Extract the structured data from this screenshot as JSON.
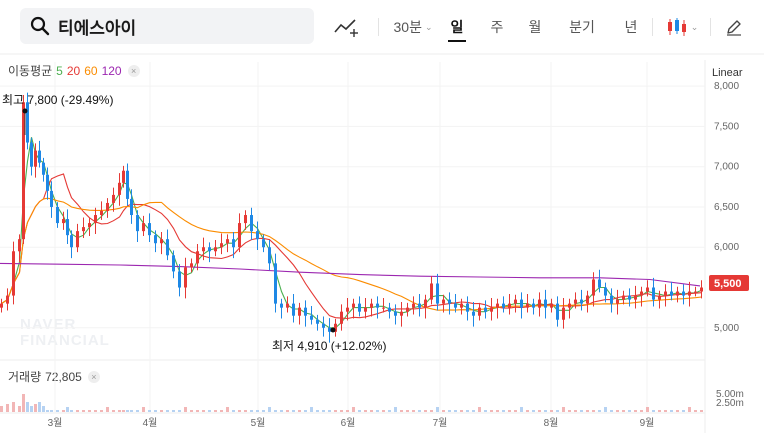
{
  "search": {
    "value": "티에스아이"
  },
  "toolbar": {
    "interval": "30분",
    "periods": [
      "일",
      "주",
      "월",
      "분기",
      "년"
    ],
    "active_period": "일"
  },
  "legends": {
    "ma_title": "이동평균",
    "ma_periods": [
      {
        "label": "5",
        "color": "#4caf50"
      },
      {
        "label": "20",
        "color": "#e53935"
      },
      {
        "label": "60",
        "color": "#fb8c00"
      },
      {
        "label": "120",
        "color": "#9c27b0"
      }
    ],
    "volume_title": "거래량",
    "volume_value": "72,805"
  },
  "scale_mode": "Linear",
  "watermark": [
    "NAVER",
    "FINANCIAL"
  ],
  "chart_data": {
    "type": "candlestick",
    "y_range": [
      4600,
      8300
    ],
    "y_ticks": [
      {
        "value": 8000,
        "label": "8,000"
      },
      {
        "value": 7500,
        "label": "7,500"
      },
      {
        "value": 7000,
        "label": "7,000"
      },
      {
        "value": 6500,
        "label": "6,500"
      },
      {
        "value": 6000,
        "label": "6,000"
      },
      {
        "value": 5000,
        "label": "5,000"
      }
    ],
    "x_ticks": [
      "3월",
      "4월",
      "5월",
      "6월",
      "7월",
      "8월",
      "9월"
    ],
    "current_price": "5,500",
    "high": {
      "price": 7800,
      "label": "최고 7,800 (-29.49%)"
    },
    "low": {
      "price": 4910,
      "label": "최저 4,910 (+12.02%)"
    },
    "volume_ticks": [
      "5.00m",
      "2.50m"
    ],
    "colors": {
      "up": "#e53935",
      "down": "#1e88e5"
    }
  }
}
